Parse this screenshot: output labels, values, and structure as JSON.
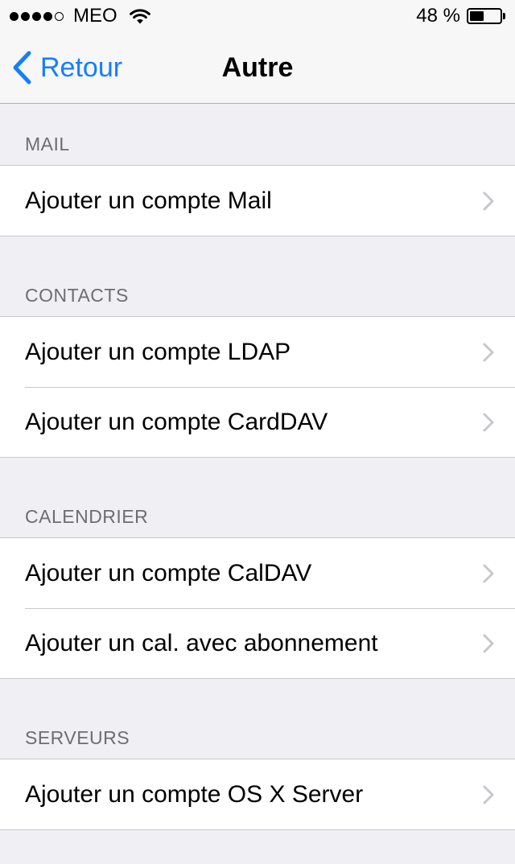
{
  "status_bar": {
    "carrier": "MEO",
    "battery_percent": "48 %",
    "battery_level": 0.48,
    "signal_bars_filled": 4,
    "signal_bars_total": 5
  },
  "nav": {
    "back_label": "Retour",
    "title": "Autre"
  },
  "colors": {
    "accent": "#157efb",
    "background": "#efeff4",
    "header_text": "#6d6d72"
  },
  "sections": [
    {
      "header": "MAIL",
      "rows": [
        {
          "label": "Ajouter un compte Mail"
        }
      ]
    },
    {
      "header": "CONTACTS",
      "rows": [
        {
          "label": "Ajouter un compte LDAP"
        },
        {
          "label": "Ajouter un compte CardDAV"
        }
      ]
    },
    {
      "header": "CALENDRIER",
      "rows": [
        {
          "label": "Ajouter un compte CalDAV"
        },
        {
          "label": "Ajouter un cal. avec abonnement"
        }
      ]
    },
    {
      "header": "SERVEURS",
      "rows": [
        {
          "label": "Ajouter un compte OS X Server"
        }
      ]
    }
  ]
}
